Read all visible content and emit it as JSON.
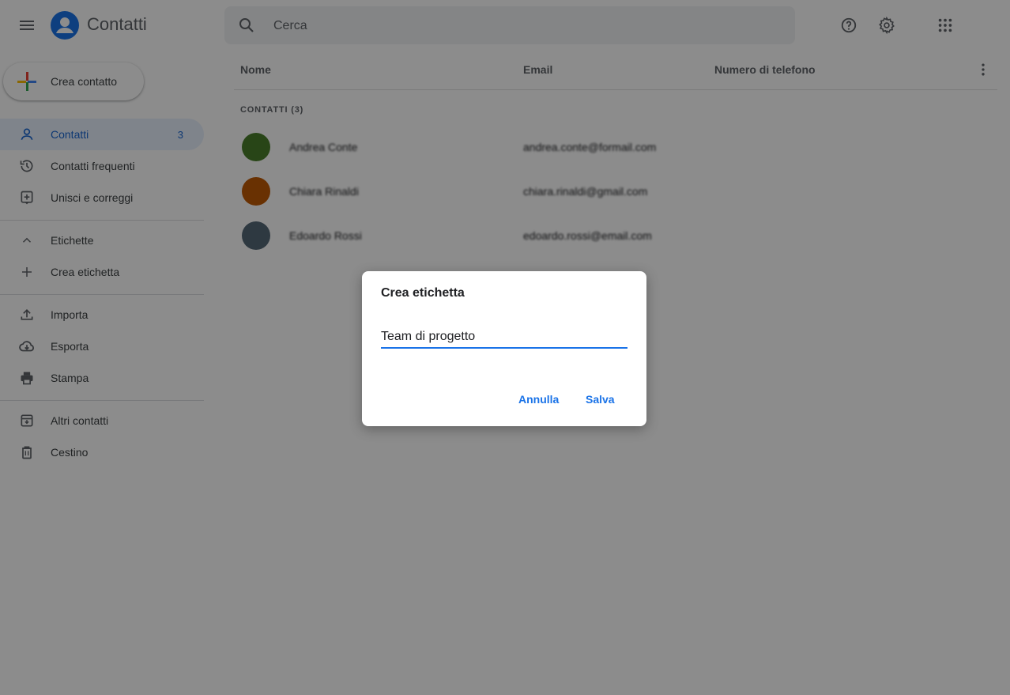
{
  "app": {
    "title": "Contatti",
    "logo_icon": "person-circle-icon",
    "brand_color": "#1a73e8"
  },
  "header": {
    "search_placeholder": "Cerca",
    "icons": [
      "menu-icon",
      "search-icon",
      "help-icon",
      "settings-icon",
      "apps-grid-icon"
    ]
  },
  "sidebar": {
    "create_label": "Crea contatto",
    "items": [
      {
        "label": "Contatti",
        "count": "3",
        "icon": "person-icon",
        "active": true
      },
      {
        "label": "Contatti frequenti",
        "icon": "history-icon"
      },
      {
        "label": "Unisci e correggi",
        "icon": "merge-icon"
      }
    ],
    "labels_section": {
      "label": "Etichette",
      "icon": "chevron-up-icon"
    },
    "create_label_item": {
      "label": "Crea etichetta",
      "icon": "plus-icon"
    },
    "tools": [
      {
        "label": "Importa",
        "icon": "upload-icon"
      },
      {
        "label": "Esporta",
        "icon": "cloud-download-icon"
      },
      {
        "label": "Stampa",
        "icon": "printer-icon"
      }
    ],
    "other": [
      {
        "label": "Altri contatti",
        "icon": "archive-icon"
      },
      {
        "label": "Cestino",
        "icon": "trash-icon"
      }
    ]
  },
  "table": {
    "columns": [
      "Nome",
      "Email",
      "Numero di telefono"
    ],
    "section_label": "CONTATTI (3)",
    "rows": [
      {
        "name": "Andrea Conte",
        "email": "andrea.conte@formail.com",
        "avatar_color": "#4a7f2a"
      },
      {
        "name": "Chiara Rinaldi",
        "email": "chiara.rinaldi@gmail.com",
        "avatar_color": "#c05a05"
      },
      {
        "name": "Edoardo Rossi",
        "email": "edoardo.rossi@email.com",
        "avatar_color": "#556877"
      }
    ]
  },
  "dialog": {
    "title": "Crea etichetta",
    "input_value": "Team di progetto",
    "cancel_label": "Annulla",
    "save_label": "Salva"
  }
}
